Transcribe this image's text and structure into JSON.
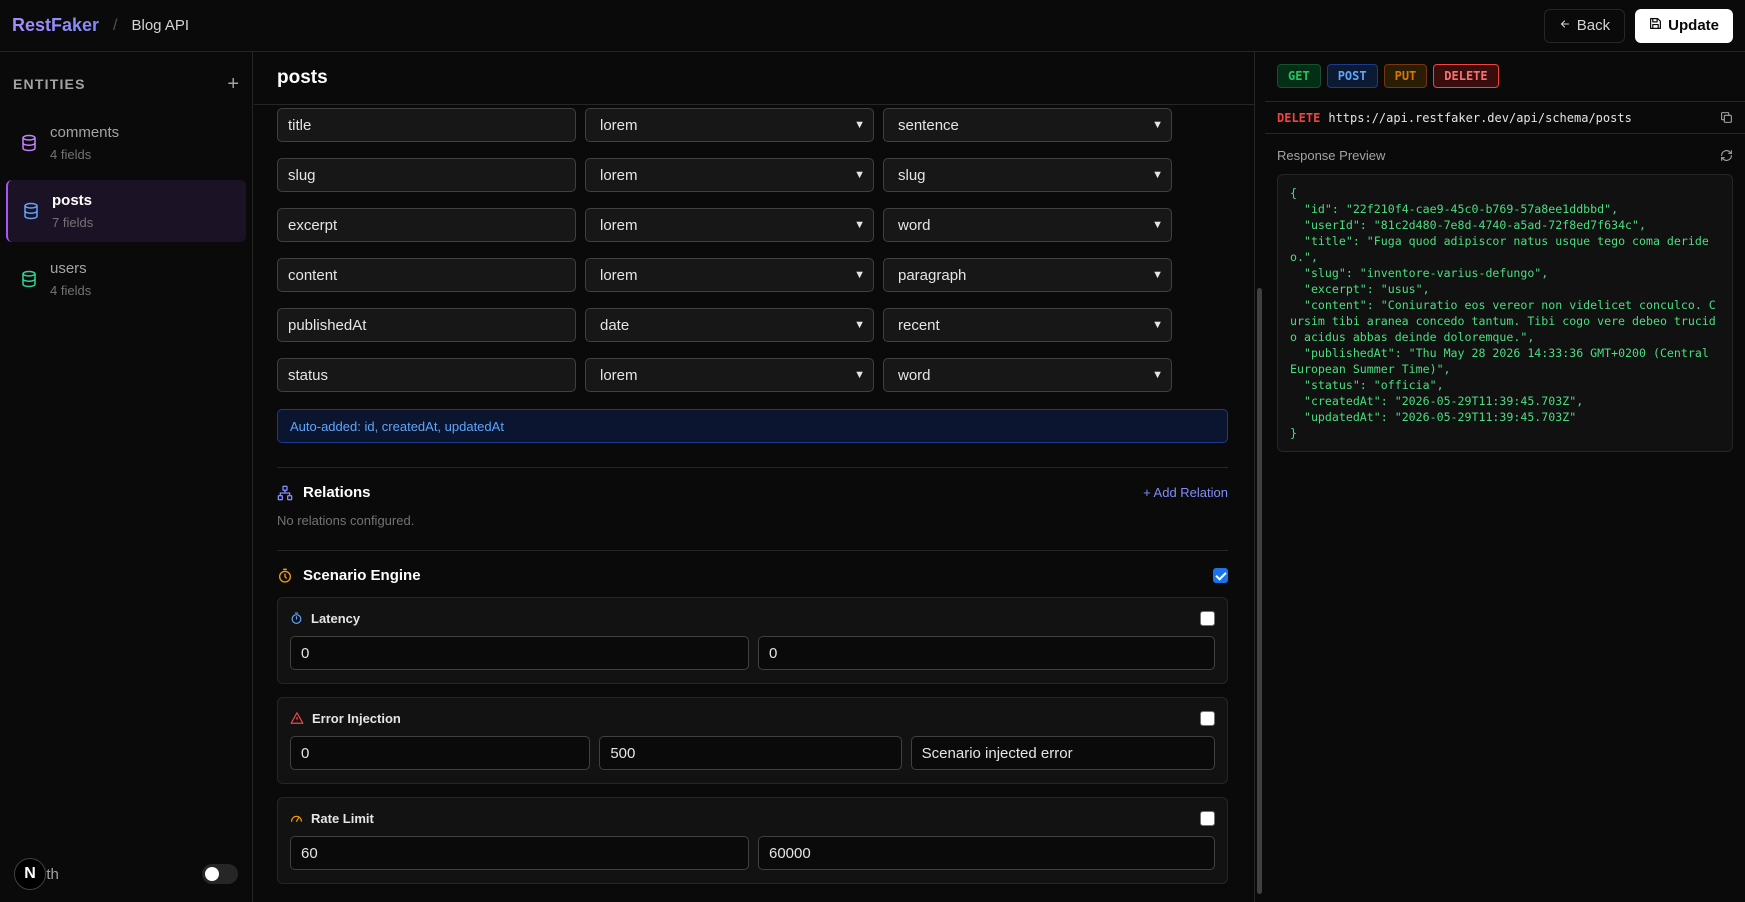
{
  "topbar": {
    "brand": "RestFaker",
    "separator": "/",
    "project": "Blog API",
    "back_label": "Back",
    "update_label": "Update"
  },
  "sidebar": {
    "title": "ENTITIES",
    "items": [
      {
        "name": "comments",
        "fields": "4 fields",
        "color": "#c084fc"
      },
      {
        "name": "posts",
        "fields": "7 fields",
        "color": "#60a5fa"
      },
      {
        "name": "users",
        "fields": "4 fields",
        "color": "#34d399"
      }
    ],
    "footer_badge": "N",
    "footer_label": "uth"
  },
  "main": {
    "title": "posts",
    "fields": [
      {
        "name": "title",
        "type": "lorem",
        "generator": "sentence"
      },
      {
        "name": "slug",
        "type": "lorem",
        "generator": "slug"
      },
      {
        "name": "excerpt",
        "type": "lorem",
        "generator": "word"
      },
      {
        "name": "content",
        "type": "lorem",
        "generator": "paragraph"
      },
      {
        "name": "publishedAt",
        "type": "date",
        "generator": "recent"
      },
      {
        "name": "status",
        "type": "lorem",
        "generator": "word"
      }
    ],
    "auto_added": "Auto-added: id, createdAt, updatedAt",
    "relations": {
      "title": "Relations",
      "add_label": "+ Add Relation",
      "empty": "No relations configured."
    },
    "scenario": {
      "title": "Scenario Engine",
      "latency": {
        "title": "Latency",
        "min": "0",
        "max": "0"
      },
      "error": {
        "title": "Error Injection",
        "rate": "0",
        "status": "500",
        "message": "Scenario injected error"
      },
      "rate_limit": {
        "title": "Rate Limit",
        "limit": "60",
        "window": "60000"
      }
    }
  },
  "preview": {
    "methods": [
      "GET",
      "POST",
      "PUT",
      "DELETE"
    ],
    "active_method": "DELETE",
    "url": "https://api.restfaker.dev/api/schema/posts",
    "response_title": "Response Preview",
    "response_json": "{\n  \"id\": \"22f210f4-cae9-45c0-b769-57a8ee1ddbbd\",\n  \"userId\": \"81c2d480-7e8d-4740-a5ad-72f8ed7f634c\",\n  \"title\": \"Fuga quod adipiscor natus usque tego coma derideo.\",\n  \"slug\": \"inventore-varius-defungo\",\n  \"excerpt\": \"usus\",\n  \"content\": \"Coniuratio eos vereor non videlicet conculco. Cursim tibi aranea concedo tantum. Tibi cogo vere debeo trucido acidus abbas deinde doloremque.\",\n  \"publishedAt\": \"Thu May 28 2026 14:33:36 GMT+0200 (Central European Summer Time)\",\n  \"status\": \"officia\",\n  \"createdAt\": \"2026-05-29T11:39:45.703Z\",\n  \"updatedAt\": \"2026-05-29T11:39:45.703Z\"\n}"
  }
}
